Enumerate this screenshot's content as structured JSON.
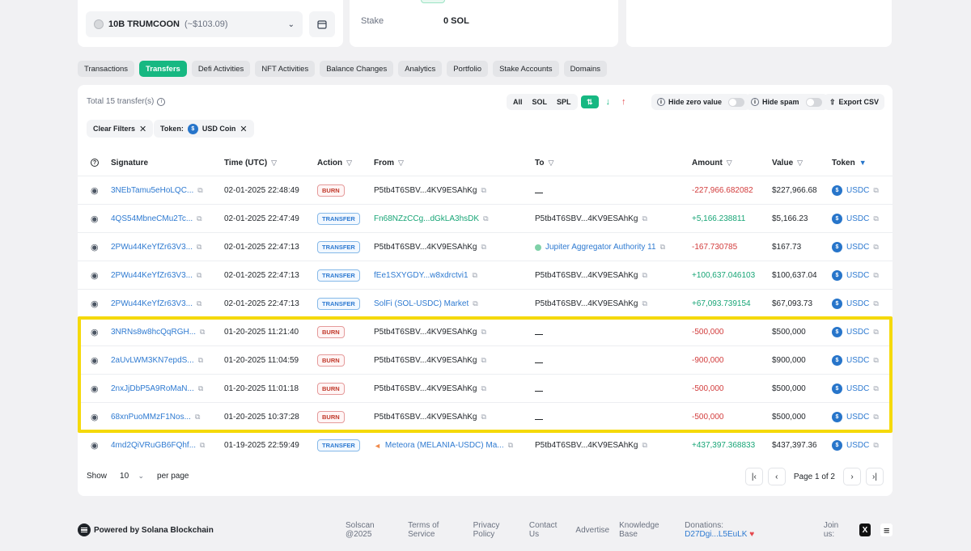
{
  "token_select": {
    "name": "10B TRUMCOON",
    "sub": "(~$103.09)"
  },
  "stake": {
    "label": "Stake",
    "value": "0 SOL"
  },
  "tabs": [
    {
      "label": "Transactions"
    },
    {
      "label": "Transfers",
      "active": true
    },
    {
      "label": "Defi Activities"
    },
    {
      "label": "NFT Activities"
    },
    {
      "label": "Balance Changes"
    },
    {
      "label": "Analytics"
    },
    {
      "label": "Portfolio"
    },
    {
      "label": "Stake Accounts"
    },
    {
      "label": "Domains"
    }
  ],
  "summary": {
    "total": "Total 15 transfer(s)"
  },
  "filters": {
    "all": "All",
    "sol": "SOL",
    "spl": "SPL",
    "hide_zero": "Hide zero value",
    "hide_spam": "Hide spam",
    "export": "Export CSV",
    "clear": "Clear Filters",
    "token_label": "Token:",
    "token_value": "USD Coin"
  },
  "columns": {
    "signature": "Signature",
    "time": "Time (UTC)",
    "action": "Action",
    "from": "From",
    "to": "To",
    "amount": "Amount",
    "value": "Value",
    "token": "Token"
  },
  "rows": [
    {
      "signature": "3NEbTamu5eHoLQC...",
      "time": "02-01-2025 22:48:49",
      "action": "BURN",
      "from": "P5tb4T6SBV...4KV9ESAhKg",
      "from_link": false,
      "to": "",
      "amount": "-227,966.682082",
      "value": "$227,966.68",
      "token": "USDC"
    },
    {
      "signature": "4QS54MbneCMu2Tc...",
      "time": "02-01-2025 22:47:49",
      "action": "TRANSFER",
      "from": "Fn68NZzCCg...dGkLA3hsDK",
      "from_link": true,
      "to": "P5tb4T6SBV...4KV9ESAhKg",
      "to_link": false,
      "amount": "+5,166.238811",
      "value": "$5,166.23",
      "token": "USDC"
    },
    {
      "signature": "2PWu44KeYfZr63V3...",
      "time": "02-01-2025 22:47:13",
      "action": "TRANSFER",
      "from": "P5tb4T6SBV...4KV9ESAhKg",
      "from_link": false,
      "to": "Jupiter Aggregator Authority 11",
      "to_link": true,
      "amount": "-167.730785",
      "value": "$167.73",
      "token": "USDC"
    },
    {
      "signature": "2PWu44KeYfZr63V3...",
      "time": "02-01-2025 22:47:13",
      "action": "TRANSFER",
      "from": "fEe1SXYGDY...w8xdrctvi1",
      "from_link": true,
      "to": "P5tb4T6SBV...4KV9ESAhKg",
      "to_link": false,
      "amount": "+100,637.046103",
      "value": "$100,637.04",
      "token": "USDC"
    },
    {
      "signature": "2PWu44KeYfZr63V3...",
      "time": "02-01-2025 22:47:13",
      "action": "TRANSFER",
      "from": "SolFi (SOL-USDC) Market",
      "from_link": true,
      "to": "P5tb4T6SBV...4KV9ESAhKg",
      "to_link": false,
      "amount": "+67,093.739154",
      "value": "$67,093.73",
      "token": "USDC"
    },
    {
      "signature": "3NRNs8w8hcQqRGH...",
      "time": "01-20-2025 11:21:40",
      "action": "BURN",
      "from": "P5tb4T6SBV...4KV9ESAhKg",
      "from_link": false,
      "to": "",
      "amount": "-500,000",
      "value": "$500,000",
      "token": "USDC"
    },
    {
      "signature": "2aUvLWM3KN7epdS...",
      "time": "01-20-2025 11:04:59",
      "action": "BURN",
      "from": "P5tb4T6SBV...4KV9ESAhKg",
      "from_link": false,
      "to": "",
      "amount": "-900,000",
      "value": "$900,000",
      "token": "USDC"
    },
    {
      "signature": "2nxJjDbP5A9RoMaN...",
      "time": "01-20-2025 11:01:18",
      "action": "BURN",
      "from": "P5tb4T6SBV...4KV9ESAhKg",
      "from_link": false,
      "to": "",
      "amount": "-500,000",
      "value": "$500,000",
      "token": "USDC"
    },
    {
      "signature": "68xnPuoMMzF1Nos...",
      "time": "01-20-2025 10:37:28",
      "action": "BURN",
      "from": "P5tb4T6SBV...4KV9ESAhKg",
      "from_link": false,
      "to": "",
      "amount": "-500,000",
      "value": "$500,000",
      "token": "USDC"
    },
    {
      "signature": "4md2QiVRuGB6FQhf...",
      "time": "01-19-2025 22:59:49",
      "action": "TRANSFER",
      "from": "Meteora (MELANIA-USDC) Ma...",
      "from_link": true,
      "to": "P5tb4T6SBV...4KV9ESAhKg",
      "to_link": false,
      "amount": "+437,397.368833",
      "value": "$437,397.36",
      "token": "USDC"
    }
  ],
  "pagination": {
    "show": "Show",
    "per_page_value": "10",
    "per_page": "per page",
    "page_text": "Page 1 of 2"
  },
  "footer": {
    "powered": "Powered by Solana Blockchain",
    "links": [
      "Solscan @2025",
      "Terms of Service",
      "Privacy Policy",
      "Contact Us",
      "Advertise",
      "Knowledge Base"
    ],
    "donations_label": "Donations:",
    "donations_addr": "D27Dgi...L5EuLK",
    "join": "Join us:"
  },
  "colors": {
    "accent": "#17b882",
    "link": "#2e7ad1",
    "negative": "#d23c3c",
    "highlight": "#f5d90a"
  }
}
